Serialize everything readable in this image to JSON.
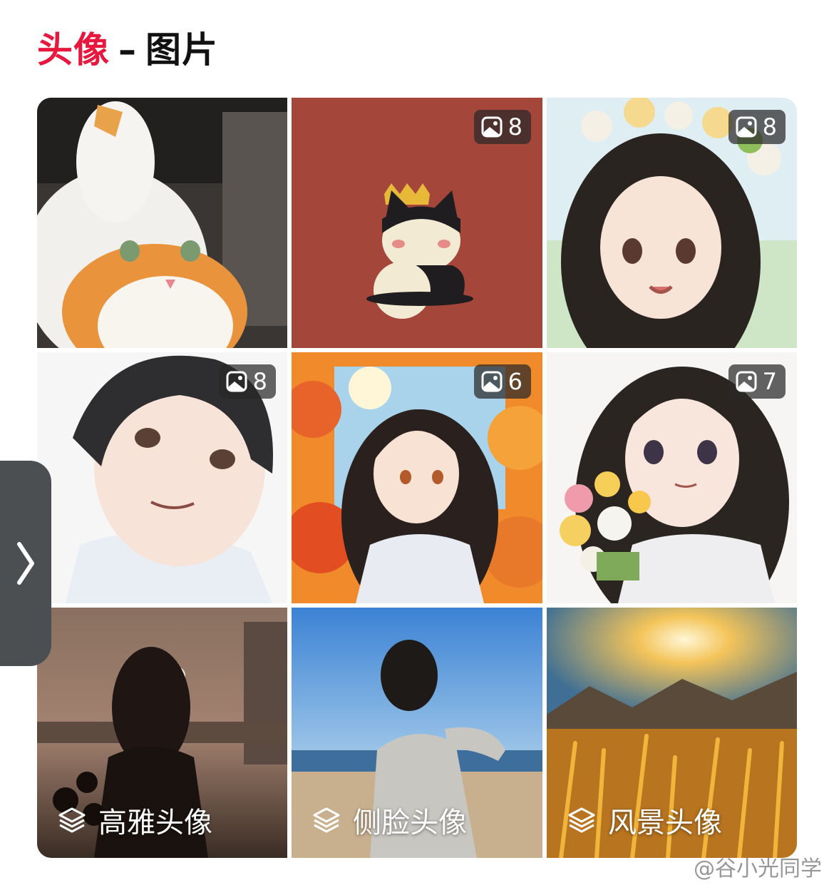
{
  "header": {
    "title_accent": "头像",
    "title_separator": "–",
    "title_rest": "图片",
    "accent_color": "#e8173e"
  },
  "grid": {
    "tiles": [
      {
        "name": "tile-cat-in-duck-hat",
        "badge_count": null,
        "caption": null
      },
      {
        "name": "tile-crowned-cartoon-cat",
        "badge_count": "8",
        "caption": null
      },
      {
        "name": "tile-flower-crown-girl",
        "badge_count": "8",
        "caption": null
      },
      {
        "name": "tile-anime-boy",
        "badge_count": "8",
        "caption": null
      },
      {
        "name": "tile-autumn-maple-girl",
        "badge_count": "6",
        "caption": null
      },
      {
        "name": "tile-girl-with-bouquet",
        "badge_count": "7",
        "caption": null
      },
      {
        "name": "tile-elegant-silhouette",
        "badge_count": null,
        "caption": "高雅头像"
      },
      {
        "name": "tile-side-profile-beach",
        "badge_count": null,
        "caption": "侧脸头像"
      },
      {
        "name": "tile-wheat-field-sunset",
        "badge_count": null,
        "caption": "风景头像"
      }
    ]
  },
  "side_handle": {
    "icon": "chevron-right-icon"
  },
  "watermark": {
    "text": "@谷小光同学",
    "icon": "weibo-logo-icon"
  }
}
